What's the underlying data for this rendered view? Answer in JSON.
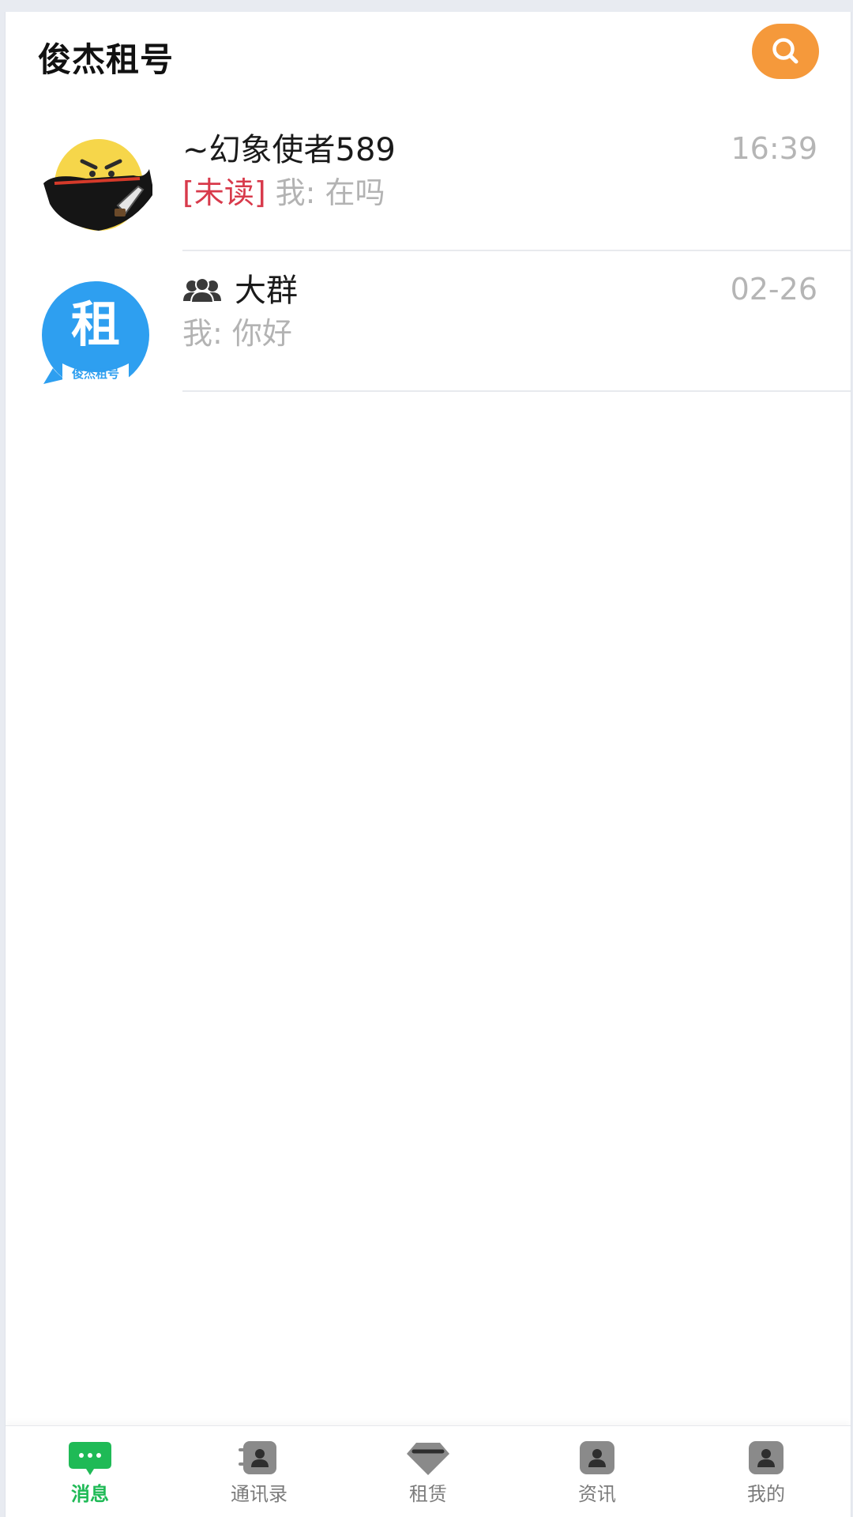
{
  "header": {
    "title": "俊杰租号",
    "accent_color": "#f5993b"
  },
  "conversations": [
    {
      "name": "~幻象使者589",
      "time": "16:39",
      "unread_tag": "[未读]",
      "preview": "我: 在吗",
      "avatar": "ninja-emoji-avatar",
      "is_group": false
    },
    {
      "name": "大群",
      "time": "02-26",
      "unread_tag": "",
      "preview": "我: 你好",
      "avatar": "rental-logo-avatar",
      "avatar_text": "租",
      "avatar_subtext": "俊杰租号",
      "is_group": true
    }
  ],
  "bottom_nav": {
    "active_color": "#1fba56",
    "items": [
      {
        "label": "消息",
        "icon": "message-icon",
        "active": true
      },
      {
        "label": "通讯录",
        "icon": "contacts-icon",
        "active": false
      },
      {
        "label": "租赁",
        "icon": "diamond-icon",
        "active": false
      },
      {
        "label": "资讯",
        "icon": "news-icon",
        "active": false
      },
      {
        "label": "我的",
        "icon": "profile-icon",
        "active": false
      }
    ]
  }
}
